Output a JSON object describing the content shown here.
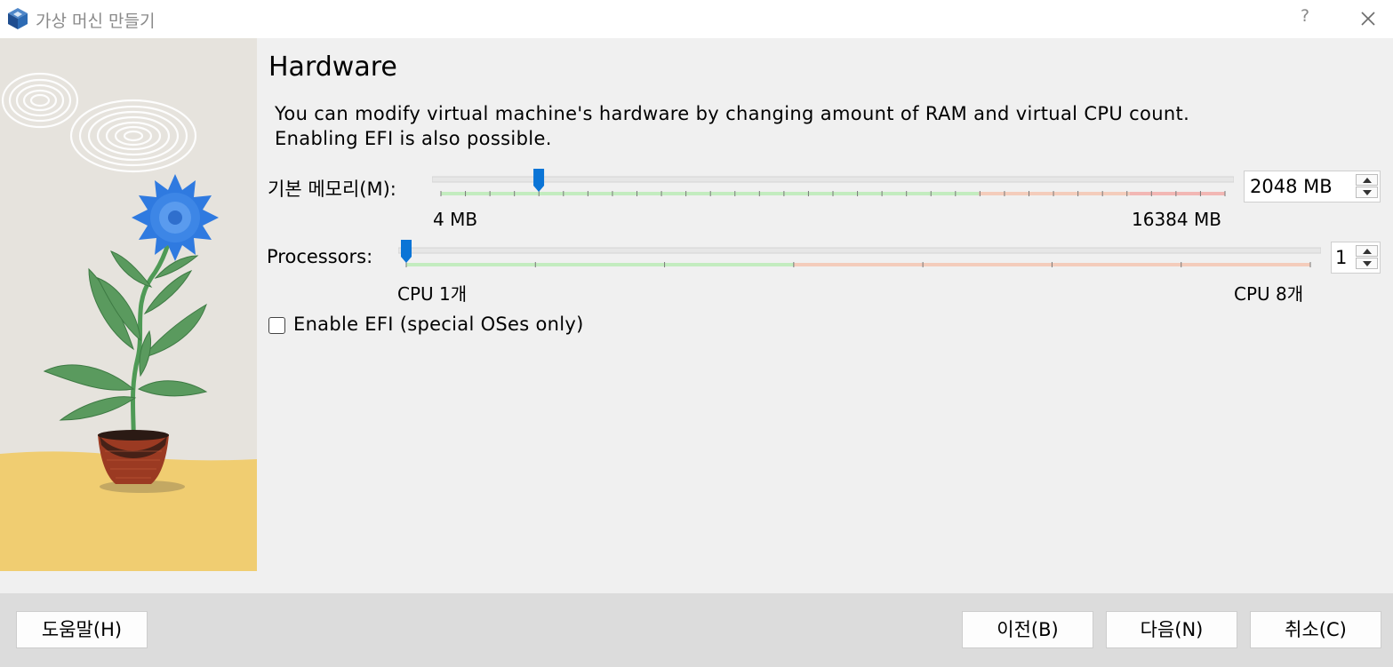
{
  "window": {
    "title": "가상 머신 만들기",
    "help_glyph": "?",
    "app_icon": "virtualbox-cube-icon",
    "close_icon": "close-icon"
  },
  "page": {
    "heading": "Hardware",
    "description_line1": "You can modify virtual machine's hardware by changing amount of RAM and virtual CPU count.",
    "description_line2": "Enabling EFI is also possible."
  },
  "memory": {
    "label": "기본 메모리(M):",
    "value": 2048,
    "min": 4,
    "max": 16384,
    "min_label": "4 MB",
    "max_label": "16384 MB",
    "spin_text": "2048 MB"
  },
  "processors": {
    "label": "Processors:",
    "value": 1,
    "min": 1,
    "max": 8,
    "min_label": "CPU 1개",
    "max_label": "CPU 8개",
    "spin_text": "1"
  },
  "efi": {
    "label": "Enable EFI (special OSes only)",
    "checked": false
  },
  "buttons": {
    "help": "도움말(H)",
    "back": "이전(B)",
    "next": "다음(N)",
    "cancel": "취소(C)"
  },
  "colors": {
    "slider_green": "#c3ecbf",
    "slider_orange": "#f4ccbb",
    "slider_red": "#f2b7b4",
    "handle_blue": "#0a74d6",
    "illustration_yellow": "#f0cd71",
    "flower_blue": "#2f7ae0",
    "pot_red": "#9b3a22"
  }
}
